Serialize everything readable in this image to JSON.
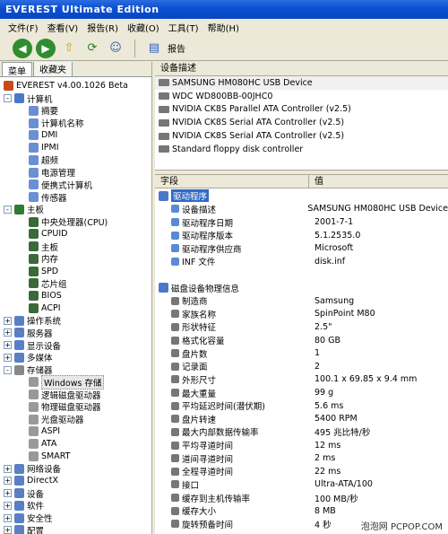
{
  "window": {
    "title": "EVEREST Ultimate Edition"
  },
  "menu": [
    "文件(F)",
    "查看(V)",
    "报告(R)",
    "收藏(O)",
    "工具(T)",
    "帮助(H)"
  ],
  "toolbar": {
    "report_label": "报告"
  },
  "tabs": [
    "菜单",
    "收藏夹"
  ],
  "tree": {
    "root": "EVEREST v4.00.1026 Beta",
    "computer": "计算机",
    "computer_children": [
      "摘要",
      "计算机名称",
      "DMI",
      "IPMI",
      "超频",
      "电源管理",
      "便携式计算机",
      "传感器"
    ],
    "motherboard": "主板",
    "motherboard_children": [
      "中央处理器(CPU)",
      "CPUID",
      "主板",
      "内存",
      "SPD",
      "芯片组",
      "BIOS",
      "ACPI"
    ],
    "mid_items": [
      "操作系统",
      "服务器",
      "显示设备",
      "多媒体"
    ],
    "storage": "存储器",
    "storage_children": [
      "Windows 存储",
      "逻辑磁盘驱动器",
      "物理磁盘驱动器",
      "光盘驱动器",
      "ASPI",
      "ATA",
      "SMART"
    ],
    "bottom_items": [
      "网络设备",
      "DirectX",
      "设备",
      "软件",
      "安全性",
      "配置"
    ]
  },
  "device_panel": {
    "header": "设备描述",
    "devices": [
      "SAMSUNG HM080HC USB Device",
      "WDC WD800BB-00JHC0",
      "NVIDIA CK8S Parallel ATA Controller (v2.5)",
      "NVIDIA CK8S Serial ATA Controller (v2.5)",
      "NVIDIA CK8S Serial ATA Controller (v2.5)",
      "Standard floppy disk controller"
    ]
  },
  "details": {
    "col_field": "字段",
    "col_value": "值",
    "section1": "驱动程序",
    "driver_rows": [
      {
        "k": "设备描述",
        "v": "SAMSUNG HM080HC USB Device"
      },
      {
        "k": "驱动程序日期",
        "v": "2001-7-1"
      },
      {
        "k": "驱动程序版本",
        "v": "5.1.2535.0"
      },
      {
        "k": "驱动程序供应商",
        "v": "Microsoft"
      },
      {
        "k": "INF 文件",
        "v": "disk.inf"
      }
    ],
    "section2": "磁盘设备物理信息",
    "phys_rows": [
      {
        "k": "制造商",
        "v": "Samsung"
      },
      {
        "k": "家族名称",
        "v": "SpinPoint M80"
      },
      {
        "k": "形状特征",
        "v": "2.5\""
      },
      {
        "k": "格式化容量",
        "v": "80 GB"
      },
      {
        "k": "盘片数",
        "v": "1"
      },
      {
        "k": "记录面",
        "v": "2"
      },
      {
        "k": "外形尺寸",
        "v": "100.1 x 69.85 x 9.4 mm"
      },
      {
        "k": "最大重量",
        "v": "99 g"
      },
      {
        "k": "平均延迟时间(潜伏期)",
        "v": "5.6 ms"
      },
      {
        "k": "盘片转速",
        "v": "5400 RPM"
      },
      {
        "k": "最大内部数据传输率",
        "v": "495 兆比特/秒"
      },
      {
        "k": "平均寻道时间",
        "v": "12 ms"
      },
      {
        "k": "道间寻道时间",
        "v": "2 ms"
      },
      {
        "k": "全程寻道时间",
        "v": "22 ms"
      },
      {
        "k": "接口",
        "v": "Ultra-ATA/100"
      },
      {
        "k": "缓存到主机传输率",
        "v": "100 MB/秒"
      },
      {
        "k": "缓存大小",
        "v": "8 MB"
      },
      {
        "k": "旋转预备时间",
        "v": "4 秒"
      }
    ]
  },
  "watermark": "泡泡网 PCPOP.COM"
}
